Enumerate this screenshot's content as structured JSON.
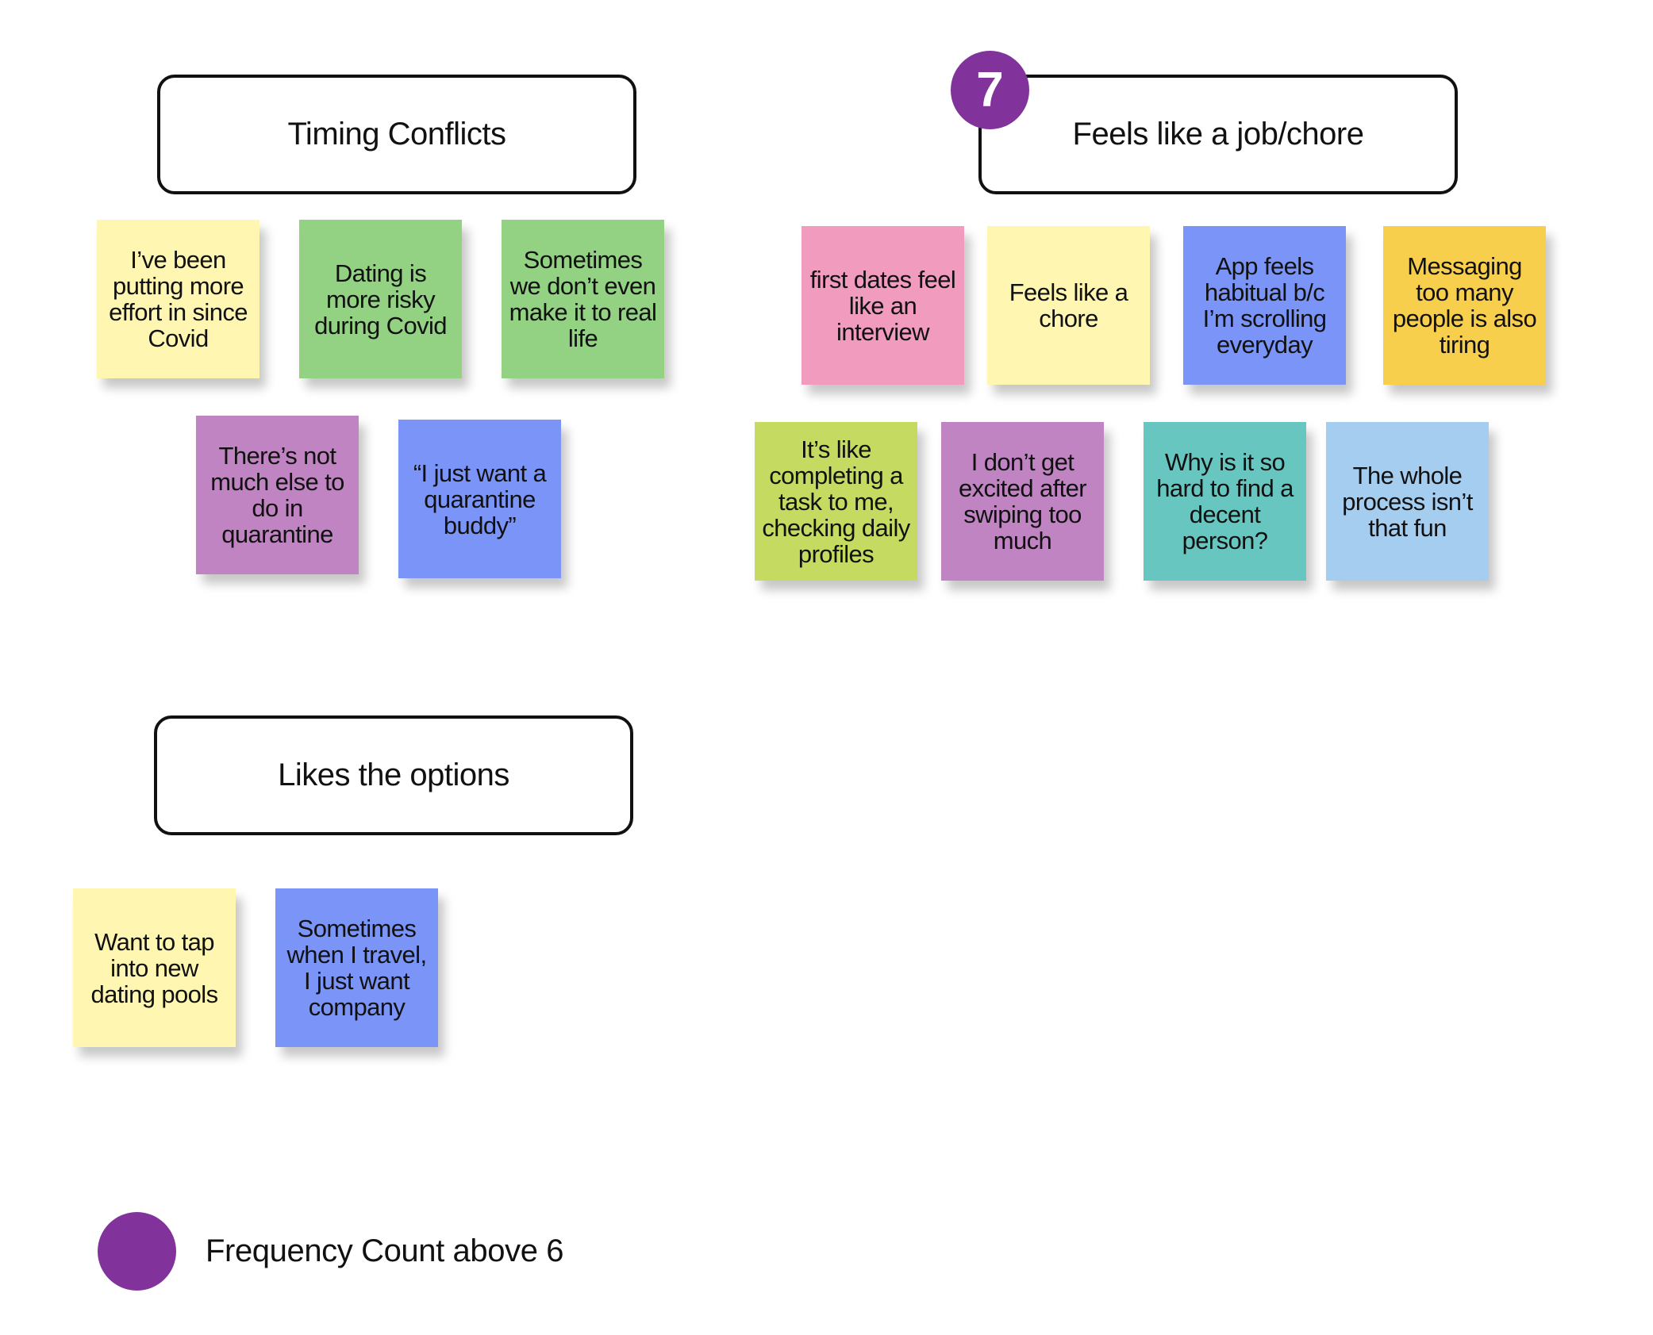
{
  "clusters": [
    {
      "title": "Timing Conflicts",
      "notes": [
        {
          "text": "I’ve been putting more effort in since Covid",
          "color": "#FEF6B1"
        },
        {
          "text": "Dating is more risky during Covid",
          "color": "#92D282"
        },
        {
          "text": "Sometimes we don’t even make it to real life",
          "color": "#92D282"
        },
        {
          "text": "There’s not much else to do in quarantine",
          "color": "#BF84C1"
        },
        {
          "text": "“I just want a quarantine buddy”",
          "color": "#7B94F8"
        }
      ]
    },
    {
      "title": "Feels like a job/chore",
      "frequency_badge": "7",
      "notes": [
        {
          "text": "first dates feel like an interview",
          "color": "#F19BBF"
        },
        {
          "text": "Feels like a chore",
          "color": "#FEF6B1"
        },
        {
          "text": "App feels habitual b/c I’m scrolling everyday",
          "color": "#7B94F8"
        },
        {
          "text": "Messaging too many people is also tiring",
          "color": "#F8CF4C"
        },
        {
          "text": "It’s like completing a task to me, checking daily profiles",
          "color": "#C5DA60"
        },
        {
          "text": "I don’t get excited after swiping too much",
          "color": "#BF84C1"
        },
        {
          "text": "Why is it so hard to find a decent person?",
          "color": "#67C7C0"
        },
        {
          "text": "The whole process isn’t that fun",
          "color": "#A5CDF0"
        }
      ]
    },
    {
      "title": "Likes the options",
      "notes": [
        {
          "text": "Want to tap into new dating pools",
          "color": "#FEF6B1"
        },
        {
          "text": "Sometimes when I travel, I just want company",
          "color": "#7B94F8"
        }
      ]
    }
  ],
  "legend": {
    "label": "Frequency Count above 6",
    "color": "#82329B"
  }
}
